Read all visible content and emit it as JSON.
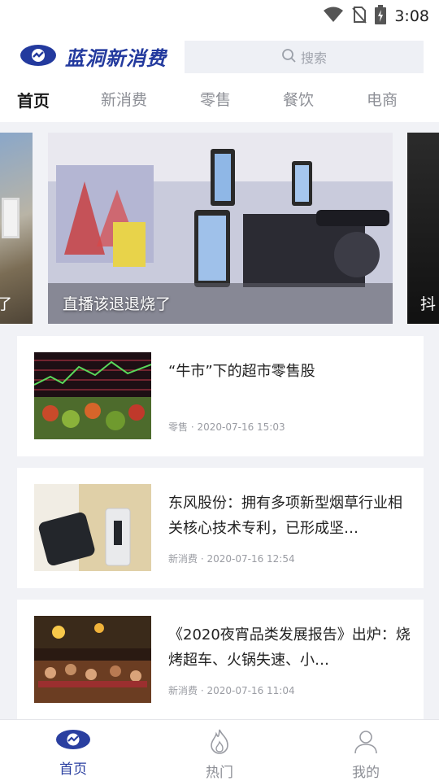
{
  "status_bar": {
    "time": "3:08",
    "icons": [
      "wifi-icon",
      "no-sim-icon",
      "battery-charging-icon"
    ]
  },
  "header": {
    "logo_text": "蓝洞新消费",
    "search_placeholder": "搜索",
    "search_icon": "search-icon"
  },
  "tabs": [
    {
      "label": "首页",
      "active": true
    },
    {
      "label": "新消费",
      "active": false
    },
    {
      "label": "零售",
      "active": false
    },
    {
      "label": "餐饮",
      "active": false
    },
    {
      "label": "电商",
      "active": false
    }
  ],
  "banner": {
    "left_edge_text": "了",
    "main_caption": "直播该退退烧了",
    "right_edge_text": "抖"
  },
  "articles": [
    {
      "title": "“牛市”下的超市零售股",
      "category": "零售",
      "timestamp": "2020-07-16 15:03"
    },
    {
      "title": "东风股份：拥有多项新型烟草行业相关核心技术专利，已形成坚…",
      "category": "新消费",
      "timestamp": "2020-07-16 12:54"
    },
    {
      "title": "《2020夜宵品类发展报告》出炉：烧烤超车、火锅失速、小…",
      "category": "新消费",
      "timestamp": "2020-07-16 11:04"
    }
  ],
  "bottom_nav": [
    {
      "label": "首页",
      "icon": "home-logo-icon",
      "active": true
    },
    {
      "label": "热门",
      "icon": "flame-icon",
      "active": false
    },
    {
      "label": "我的",
      "icon": "user-icon",
      "active": false
    }
  ],
  "colors": {
    "brand": "#233a9e",
    "active_nav": "#2a3fa0",
    "background": "#f1f2f6"
  }
}
